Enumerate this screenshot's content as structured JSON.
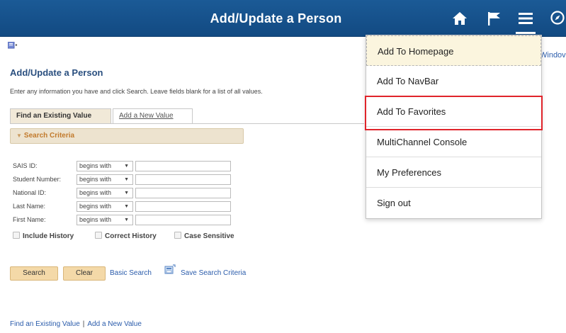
{
  "header": {
    "title": "Add/Update a Person",
    "icons": [
      "home-icon",
      "flag-icon",
      "menu-icon",
      "compass-icon"
    ]
  },
  "window_link": "Windov",
  "page": {
    "title": "Add/Update a Person",
    "instructions": "Enter any information you have and click Search. Leave fields blank for a list of all values."
  },
  "tabs": {
    "find": "Find an Existing Value",
    "add": "Add a New Value"
  },
  "search_criteria": {
    "label": "Search Criteria",
    "fields": [
      {
        "label": "SAIS ID:",
        "operator": "begins with"
      },
      {
        "label": "Student Number:",
        "operator": "begins with"
      },
      {
        "label": "National ID:",
        "operator": "begins with"
      },
      {
        "label": "Last Name:",
        "operator": "begins with"
      },
      {
        "label": "First Name:",
        "operator": "begins with"
      }
    ],
    "checkboxes": {
      "include_history": "Include History",
      "correct_history": "Correct History",
      "case_sensitive": "Case Sensitive"
    }
  },
  "actions": {
    "search": "Search",
    "clear": "Clear",
    "basic_search": "Basic Search",
    "save_search": "Save Search Criteria"
  },
  "footer": {
    "find": "Find an Existing Value",
    "separator": "|",
    "add": "Add a New Value"
  },
  "dropdown": {
    "items": [
      "Add To Homepage",
      "Add To NavBar",
      "Add To Favorites",
      "MultiChannel Console",
      "My Preferences",
      "Sign out"
    ],
    "highlighted": "Add To Favorites"
  },
  "colors": {
    "header": "#1b5a96",
    "accent_tab": "#f1e9d8",
    "button": "#f4d9a8",
    "link": "#2b5cab",
    "highlight": "#e0242b"
  }
}
